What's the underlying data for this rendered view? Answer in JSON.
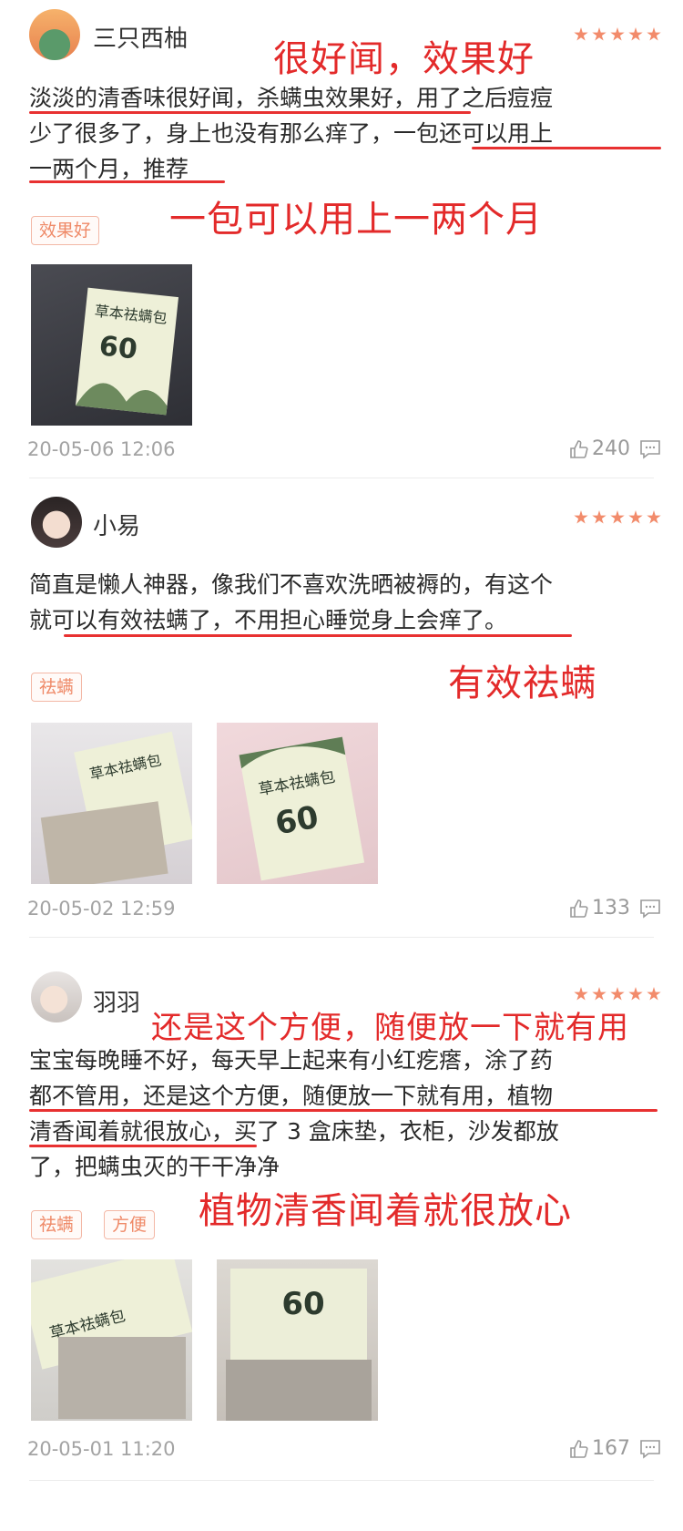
{
  "colors": {
    "accent_red": "#e32a2a",
    "tag_orange": "#ef8a68",
    "star": "#f28b6b",
    "muted": "#a3a3a3"
  },
  "reviews": [
    {
      "user": "三只西柚",
      "rating": 5,
      "lines": [
        "淡淡的清香味很好闻，杀螨虫效果好，用了之后痘痘",
        "少了很多了，身上也没有那么痒了，一包还可以用上",
        "一两个月，推荐"
      ],
      "annotations": [
        "很好闻，效果好",
        "一包可以用上一两个月"
      ],
      "tags": [
        "效果好"
      ],
      "date": "20-05-06 12:06",
      "likes": "240"
    },
    {
      "user": "小易",
      "rating": 5,
      "lines": [
        "简直是懒人神器，像我们不喜欢洗晒被褥的，有这个",
        "就可以有效祛螨了，不用担心睡觉身上会痒了。"
      ],
      "annotations": [
        "有效祛螨"
      ],
      "tags": [
        "祛螨"
      ],
      "date": "20-05-02 12:59",
      "likes": "133"
    },
    {
      "user": "羽羽",
      "rating": 5,
      "lines": [
        "宝宝每晚睡不好，每天早上起来有小红疙瘩，涂了药",
        "都不管用，还是这个方便，随便放一下就有用，植物",
        "清香闻着就很放心，买了 3 盒床垫，衣柜，沙发都放",
        "了，把螨虫灭的干干净净"
      ],
      "annotations": [
        "还是这个方便，随便放一下就有用",
        "植物清香闻着就很放心"
      ],
      "tags": [
        "祛螨",
        "方便"
      ],
      "date": "20-05-01 11:20",
      "likes": "167"
    }
  ],
  "product": {
    "box_label": "草本祛螨包",
    "box_number": "60"
  },
  "icons": {
    "like": "thumbs-up-icon",
    "comment": "comment-icon",
    "star": "star-icon"
  }
}
